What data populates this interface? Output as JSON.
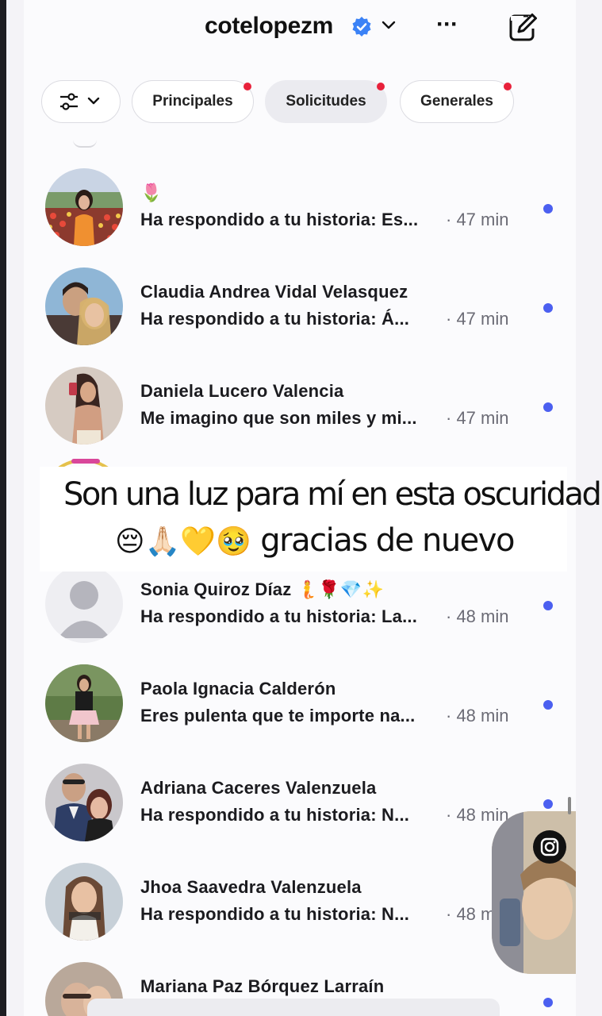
{
  "header": {
    "username": "cotelopezm",
    "more_label": "···"
  },
  "chips": {
    "principales": "Principales",
    "solicitudes": "Solicitudes",
    "generales": "Generales"
  },
  "conversations": [
    {
      "name": "🌷",
      "message": "Ha respondido a tu historia: Es...",
      "time": "· 47 min"
    },
    {
      "name": "Claudia Andrea Vidal Velasquez",
      "message": "Ha respondido a tu historia: Á...",
      "time": "· 47 min"
    },
    {
      "name": "Daniela Lucero Valencia",
      "message": "Me imagino que son miles y mi...",
      "time": "· 47 min"
    },
    {
      "name": "Sonia Quiroz Díaz 🧜🌹💎✨",
      "message": "Ha respondido a tu historia: La...",
      "time": "· 48 min"
    },
    {
      "name": "Paola Ignacia Calderón",
      "message": "Eres pulenta que te importe na...",
      "time": "· 48 min"
    },
    {
      "name": "Adriana Caceres Valenzuela",
      "message": "Ha respondido a tu historia: N...",
      "time": "· 48 min"
    },
    {
      "name": "Jhoa Saavedra Valenzuela",
      "message": "Ha respondido a tu historia: N...",
      "time": "· 48 m"
    },
    {
      "name": "Mariana Paz Bórquez Larraín",
      "message": "",
      "time": ""
    }
  ],
  "caption": {
    "line1": "Son una luz para mí en esta oscuridad",
    "emojis": "😔🙏🏻💛🥹",
    "line2": "gracias de nuevo"
  },
  "colors": {
    "unread_dot": "#4b5ff0",
    "notification_dot": "#e8213b",
    "verified": "#3b82f6"
  }
}
